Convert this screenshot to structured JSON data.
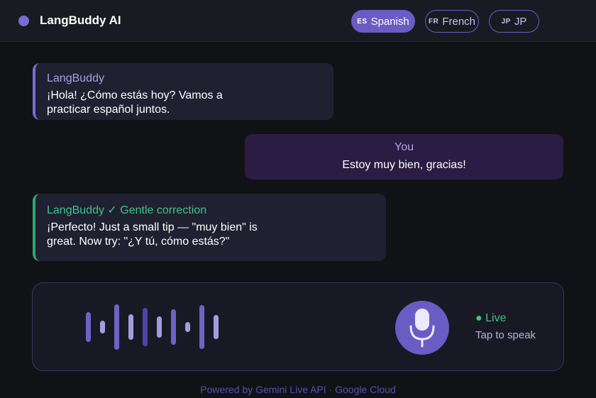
{
  "header": {
    "title": "LangBuddy AI",
    "languages": [
      {
        "code": "ES",
        "label": "Spanish",
        "active": true
      },
      {
        "code": "FR",
        "label": "French",
        "active": false
      },
      {
        "code": "JP",
        "label": "JP",
        "active": false
      }
    ]
  },
  "messages": [
    {
      "sender": "LangBuddy",
      "text": "¡Hola! ¿Cómo estás hoy? Vamos a practicar español juntos."
    },
    {
      "sender": "You",
      "text": "Estoy muy bien, gracias!"
    },
    {
      "sender": "LangBuddy ✓ Gentle correction",
      "text": "¡Perfecto! Just a small tip — \"muy bien\" is great. Now try: \"¿Y tú, cómo estás?\""
    }
  ],
  "voice": {
    "status": "● Live",
    "hint": "Tap to speak",
    "waveform_levels": [
      0.45,
      0.2,
      0.7,
      0.4,
      0.58,
      0.33,
      0.55,
      0.15,
      0.68,
      0.38
    ]
  },
  "footer": {
    "text": "Powered by Gemini Live API · Google Cloud"
  },
  "colors": {
    "accent": "#6a5bc5",
    "accent_light": "#7b6bd3",
    "success": "#3fc48e",
    "background": "#111216",
    "user_bubble": "#2a1c42",
    "bot_bubble": "#1f2130"
  }
}
